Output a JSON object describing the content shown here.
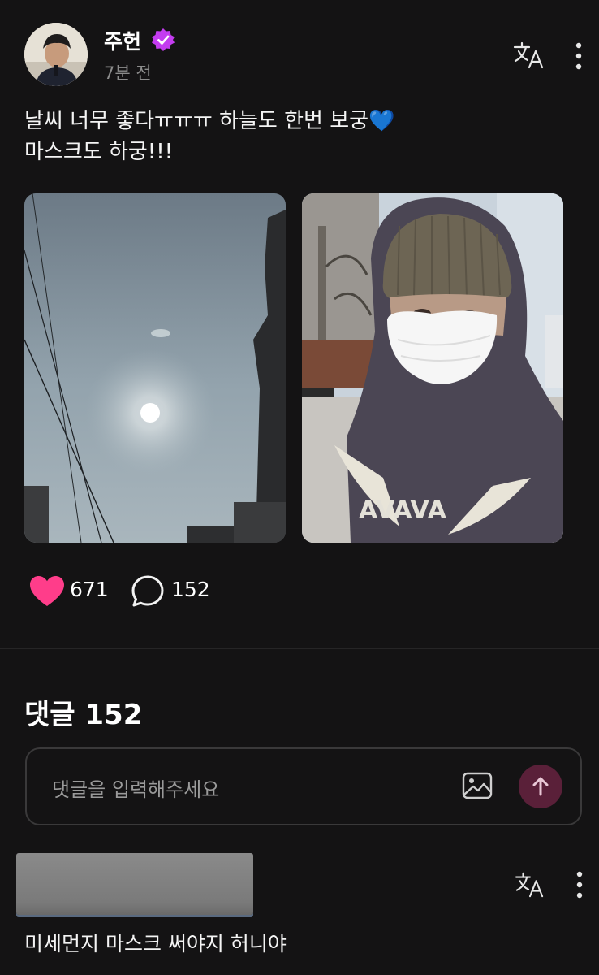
{
  "post": {
    "author": "주헌",
    "time": "7분 전",
    "text_line1": "날씨 너무 좋다ㅠㅠㅠ 하늘도 한번 보궁💙",
    "text_line2": "마스크도 하궁!!!",
    "likes": "671",
    "comments": "152"
  },
  "comments_section": {
    "heading": "댓글 152",
    "input_placeholder": "댓글을 입력해주세요"
  },
  "first_comment": {
    "text": "미세먼지 마스크 써야지 허니야"
  },
  "icons": {
    "verified": "verified-badge-icon",
    "translate": "translate-icon",
    "more": "more-vertical-icon",
    "like": "heart-icon",
    "comment": "speech-bubble-icon",
    "image": "image-icon",
    "send": "arrow-up-icon"
  },
  "colors": {
    "background": "#141314",
    "heart": "#ff3d8a",
    "verified": "#c43cf0",
    "send_button": "#5a2039"
  }
}
